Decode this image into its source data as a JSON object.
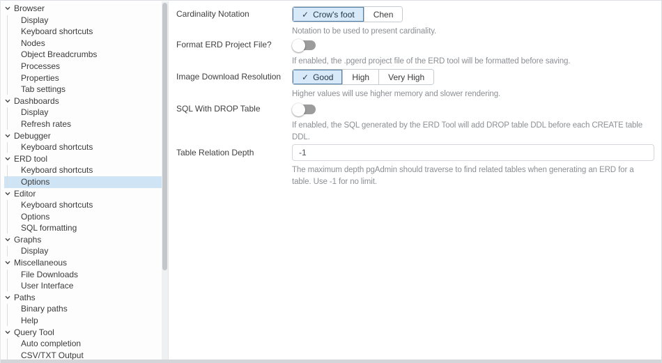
{
  "sidebar": {
    "groups": [
      {
        "label": "Browser",
        "children": [
          "Display",
          "Keyboard shortcuts",
          "Nodes",
          "Object Breadcrumbs",
          "Processes",
          "Properties",
          "Tab settings"
        ]
      },
      {
        "label": "Dashboards",
        "children": [
          "Display",
          "Refresh rates"
        ]
      },
      {
        "label": "Debugger",
        "children": [
          "Keyboard shortcuts"
        ]
      },
      {
        "label": "ERD tool",
        "children": [
          "Keyboard shortcuts",
          "Options"
        ]
      },
      {
        "label": "Editor",
        "children": [
          "Keyboard shortcuts",
          "Options",
          "SQL formatting"
        ]
      },
      {
        "label": "Graphs",
        "children": [
          "Display"
        ]
      },
      {
        "label": "Miscellaneous",
        "children": [
          "File Downloads",
          "User Interface"
        ]
      },
      {
        "label": "Paths",
        "children": [
          "Binary paths",
          "Help"
        ]
      },
      {
        "label": "Query Tool",
        "children": [
          "Auto completion",
          "CSV/TXT Output"
        ]
      }
    ],
    "selected_group": "ERD tool",
    "selected_item": "Options"
  },
  "settings": {
    "rows": [
      {
        "label": "Cardinality Notation",
        "type": "button-group",
        "options": [
          "Crow's foot",
          "Chen"
        ],
        "selected": "Crow's foot",
        "help": "Notation to be used to present cardinality."
      },
      {
        "label": "Format ERD Project File?",
        "type": "switch",
        "value": "off",
        "help": "If enabled, the .pgerd project file of the ERD tool will be formatted before saving."
      },
      {
        "label": "Image Download Resolution",
        "type": "button-group",
        "options": [
          "Good",
          "High",
          "Very High"
        ],
        "selected": "Good",
        "help": "Higher values will use higher memory and slower rendering."
      },
      {
        "label": "SQL With DROP Table",
        "type": "switch",
        "value": "off",
        "help": "If enabled, the SQL generated by the ERD Tool will add DROP table DDL before each CREATE table DDL."
      },
      {
        "label": "Table Relation Depth",
        "type": "input",
        "value": "-1",
        "help": "The maximum depth pgAdmin should traverse to find related tables when generating an ERD for a table. Use -1 for no limit."
      }
    ]
  },
  "icons": {
    "check": "✓",
    "chevron_down": "chevron-down"
  },
  "colors": {
    "selected_tree_item_bg": "#cfe4f5",
    "selected_toggle_bg": "#d8eafa",
    "selected_toggle_border": "#4f7fa9",
    "switch_track_off": "#9c9c9c",
    "help_text": "#8c8f93"
  }
}
